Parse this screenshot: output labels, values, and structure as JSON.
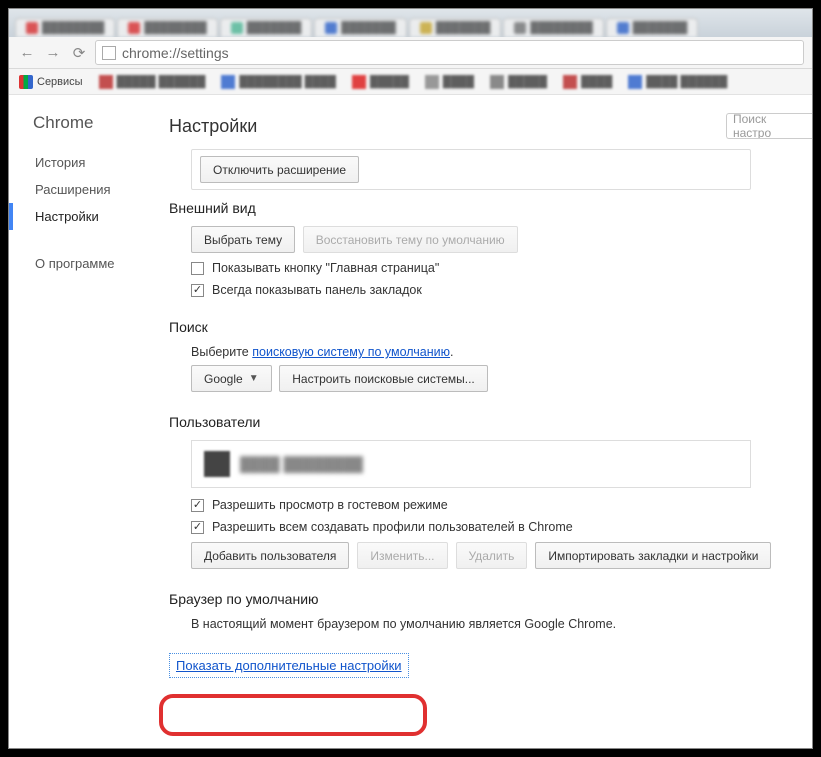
{
  "omnibox": {
    "url": "chrome://settings"
  },
  "bookmarks": {
    "apps_label": "Сервисы"
  },
  "sidebar": {
    "brand": "Chrome",
    "items": [
      {
        "label": "История"
      },
      {
        "label": "Расширения"
      },
      {
        "label": "Настройки"
      },
      {
        "label": "О программе"
      }
    ],
    "active_index": 2
  },
  "page": {
    "title": "Настройки",
    "search_placeholder": "Поиск настро"
  },
  "ext_panel": {
    "disable_ext_btn": "Отключить расширение"
  },
  "appearance": {
    "heading": "Внешний вид",
    "choose_theme_btn": "Выбрать тему",
    "reset_theme_btn": "Восстановить тему по умолчанию",
    "show_home_label": "Показывать кнопку \"Главная страница\"",
    "always_show_bm_label": "Всегда показывать панель закладок",
    "show_home_checked": false,
    "always_show_bm_checked": true
  },
  "search": {
    "heading": "Поиск",
    "desc_prefix": "Выберите ",
    "desc_link": "поисковую систему по умолчанию",
    "desc_suffix": ".",
    "engine_btn": "Google",
    "manage_btn": "Настроить поисковые системы..."
  },
  "users": {
    "heading": "Пользователи",
    "guest_label": "Разрешить просмотр в гостевом режиме",
    "guest_checked": true,
    "create_label": "Разрешить всем создавать профили пользователей в Chrome",
    "create_checked": true,
    "add_btn": "Добавить пользователя",
    "edit_btn": "Изменить...",
    "delete_btn": "Удалить",
    "import_btn": "Импортировать закладки и настройки"
  },
  "default_browser": {
    "heading": "Браузер по умолчанию",
    "status": "В настоящий момент браузером по умолчанию является Google Chrome."
  },
  "advanced_link": "Показать дополнительные настройки"
}
